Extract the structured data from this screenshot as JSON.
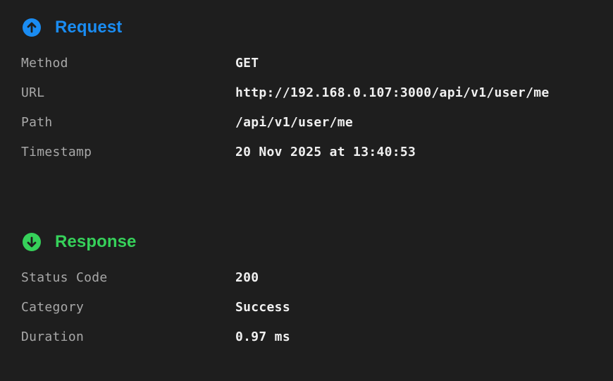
{
  "request": {
    "title": "Request",
    "icon": "arrow-up-circle-icon",
    "accent_color": "#1a8cf2",
    "rows": [
      {
        "label": "Method",
        "value": "GET"
      },
      {
        "label": "URL",
        "value": "http://192.168.0.107:3000/api/v1/user/me"
      },
      {
        "label": "Path",
        "value": "/api/v1/user/me"
      },
      {
        "label": "Timestamp",
        "value": "20 Nov 2025 at 13:40:53"
      }
    ]
  },
  "response": {
    "title": "Response",
    "icon": "arrow-down-circle-icon",
    "accent_color": "#36d15a",
    "rows": [
      {
        "label": "Status Code",
        "value": "200"
      },
      {
        "label": "Category",
        "value": "Success"
      },
      {
        "label": "Duration",
        "value": "0.97 ms"
      }
    ]
  }
}
